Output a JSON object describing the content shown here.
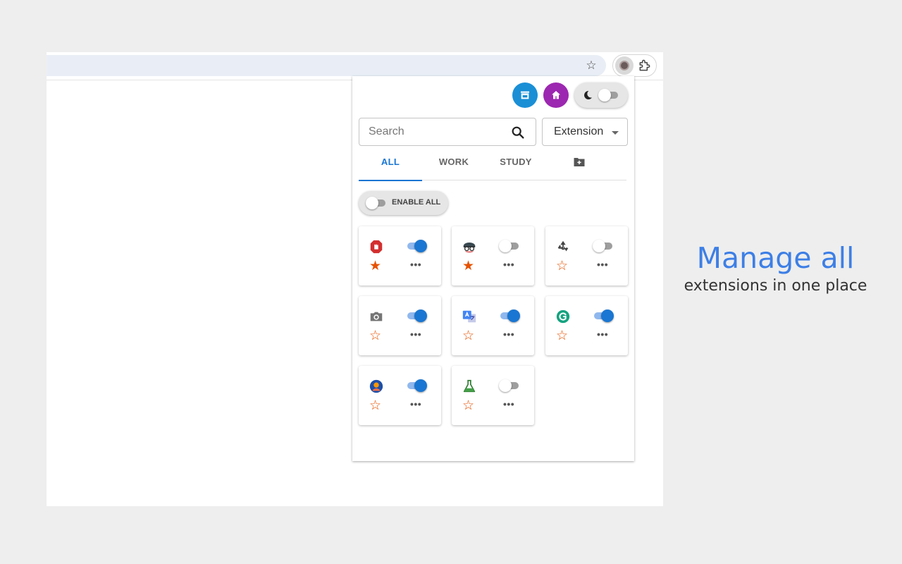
{
  "toolbar": {
    "bookmark_icon": "star-outline-icon",
    "extension_icons": [
      "extension-manager-icon",
      "puzzle-icon"
    ]
  },
  "popup": {
    "header_buttons": [
      {
        "icon": "store-icon",
        "color": "#1a8fd6"
      },
      {
        "icon": "home-icon",
        "color": "#9c27b0"
      },
      {
        "icon": "moon-icon",
        "switch_on": false
      }
    ],
    "search": {
      "placeholder": "Search",
      "value": ""
    },
    "filter": {
      "selected": "Extension"
    },
    "tabs": [
      {
        "label": "ALL",
        "active": true
      },
      {
        "label": "WORK",
        "active": false
      },
      {
        "label": "STUDY",
        "active": false
      },
      {
        "label": "",
        "icon": "add-folder-icon",
        "active": false
      }
    ],
    "enable_all": {
      "label": "ENABLE ALL",
      "on": false
    },
    "extensions": [
      {
        "icon": "red-shield-icon",
        "enabled": true,
        "favorite": true
      },
      {
        "icon": "spy-face-icon",
        "enabled": false,
        "favorite": true
      },
      {
        "icon": "recycle-icon",
        "enabled": false,
        "favorite": false
      },
      {
        "icon": "camera-icon",
        "enabled": true,
        "favorite": false
      },
      {
        "icon": "translate-icon",
        "enabled": true,
        "favorite": false
      },
      {
        "icon": "grammarly-icon",
        "enabled": true,
        "favorite": false
      },
      {
        "icon": "blue-avatar-icon",
        "enabled": true,
        "favorite": false
      },
      {
        "icon": "flask-icon",
        "enabled": false,
        "favorite": false
      }
    ],
    "more_label": "•••",
    "star_filled": "★",
    "star_outline": "☆"
  },
  "tagline": {
    "headline": "Manage all",
    "subline": "extensions in one place",
    "accent_color": "#3d7fe6"
  }
}
